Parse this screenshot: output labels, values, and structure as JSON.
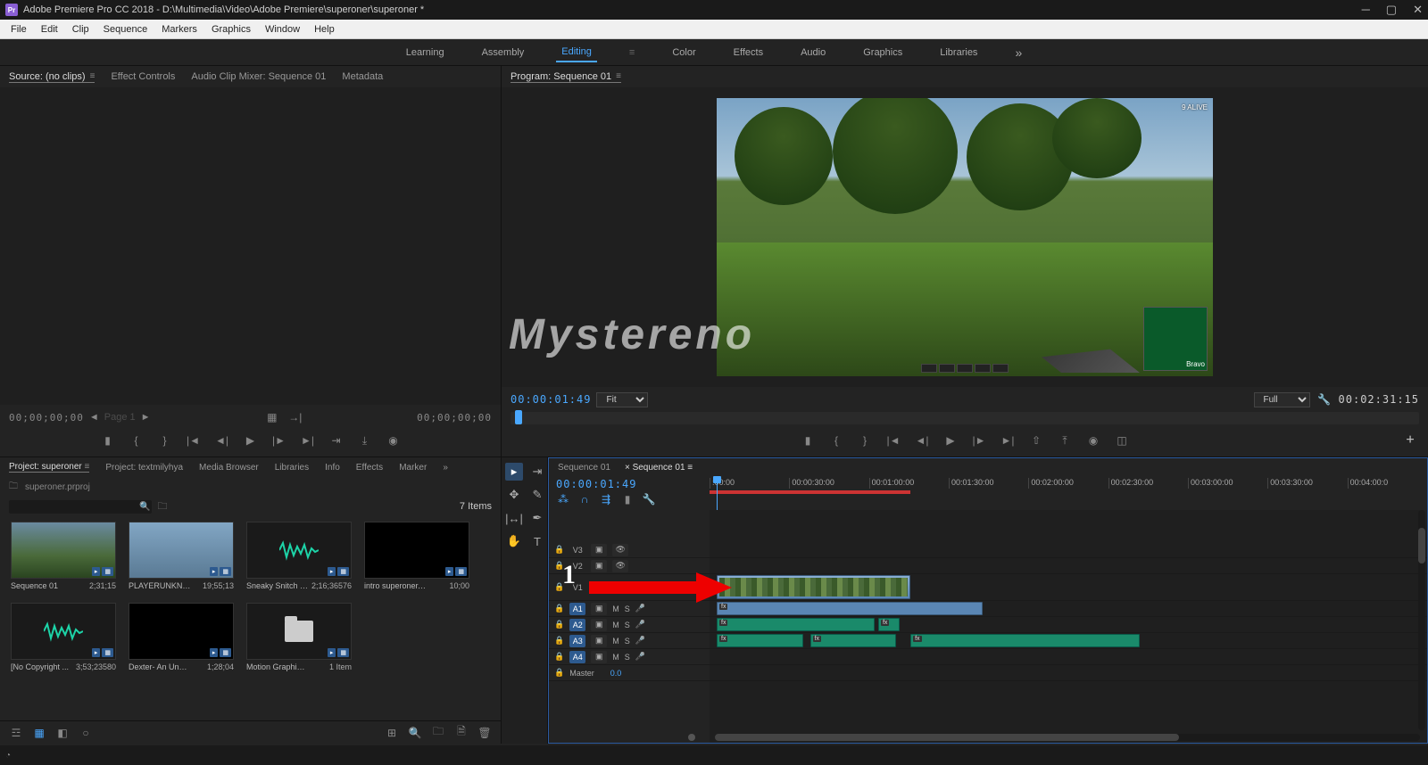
{
  "titlebar": {
    "logo": "Pr",
    "title": "Adobe Premiere Pro CC 2018 - D:\\Multimedia\\Video\\Adobe Premiere\\superoner\\superoner *"
  },
  "menubar": [
    "File",
    "Edit",
    "Clip",
    "Sequence",
    "Markers",
    "Graphics",
    "Window",
    "Help"
  ],
  "workspaces": [
    "Learning",
    "Assembly",
    "Editing",
    "Color",
    "Effects",
    "Audio",
    "Graphics",
    "Libraries"
  ],
  "workspace_active": "Editing",
  "source_tabs": [
    "Source: (no clips)",
    "Effect Controls",
    "Audio Clip Mixer: Sequence 01",
    "Metadata"
  ],
  "source_tc_left": "00;00;00;00",
  "source_page": "Page 1",
  "source_tc_right": "00;00;00;00",
  "program_tab": "Program: Sequence 01",
  "program_tc_left": "00:00:01:49",
  "program_fit": "Fit",
  "program_res": "Full",
  "program_tc_right": "00:02:31:15",
  "preview": {
    "hud": "9 ALIVE",
    "minimap_label": "Bravo"
  },
  "watermark": "Mystereno",
  "project_tabs": [
    "Project: superoner",
    "Project: textmilyhya",
    "Media Browser",
    "Libraries",
    "Info",
    "Effects",
    "Marker"
  ],
  "project_bin": "superoner.prproj",
  "project_item_count": "7 Items",
  "bins": [
    {
      "name": "Sequence 01",
      "dur": "2;31;15",
      "type": "forest"
    },
    {
      "name": "PLAYERUNKNOWN...",
      "dur": "19;55;13",
      "type": "para"
    },
    {
      "name": "Sneaky Snitch -...",
      "dur": "2;16;36576",
      "type": "audio"
    },
    {
      "name": "intro superoner.mp4",
      "dur": "10;00",
      "type": "black"
    },
    {
      "name": "[No Copyright ...",
      "dur": "3;53;23580",
      "type": "audio"
    },
    {
      "name": "Dexter- An Unpleas...",
      "dur": "1;28;04",
      "type": "black"
    },
    {
      "name": "Motion Graphics T...",
      "dur": "1 Item",
      "type": "folder"
    }
  ],
  "timeline": {
    "tabs": [
      "Sequence 01",
      "Sequence 01"
    ],
    "tc": "00:00:01:49",
    "ruler": [
      ":00:00",
      "00:00:30:00",
      "00:01:00:00",
      "00:01:30:00",
      "00:02:00:00",
      "00:02:30:00",
      "00:03:00:00",
      "00:03:30:00",
      "00:04:00:0"
    ],
    "tracks": {
      "v3": {
        "lab": "V3"
      },
      "v2": {
        "lab": "V2"
      },
      "v1": {
        "lab": "V1"
      },
      "a1": {
        "lab": "A1"
      },
      "a2": {
        "lab": "A2"
      },
      "a3": {
        "lab": "A3"
      },
      "a4": {
        "lab": "A4"
      },
      "master": {
        "lab": "Master",
        "val": "0.0"
      }
    },
    "btns": {
      "m": "M",
      "s": "S"
    }
  },
  "annotation": {
    "number": "1"
  }
}
